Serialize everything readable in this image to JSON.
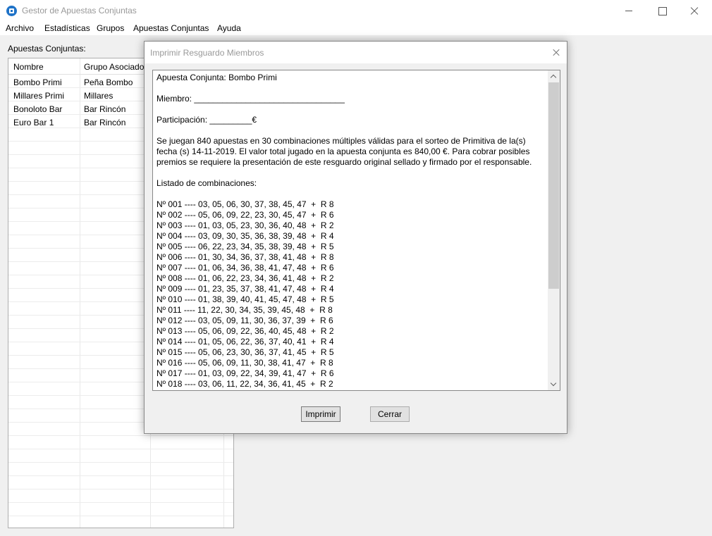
{
  "window": {
    "title": "Gestor de Apuestas Conjuntas"
  },
  "menu": [
    "Archivo",
    "Estadísticas",
    "Grupos",
    "Apuestas Conjuntas",
    "Ayuda"
  ],
  "sidebar": {
    "label": "Apuestas Conjuntas:",
    "columns": [
      "Nombre",
      "Grupo Asociado"
    ],
    "rows": [
      [
        "Bombo Primi",
        "Peña Bombo"
      ],
      [
        "Millares Primi",
        "Millares"
      ],
      [
        "Bonoloto Bar",
        "Bar Rincón"
      ],
      [
        "Euro Bar 1",
        "Bar Rincón"
      ]
    ]
  },
  "dialog": {
    "title": "Imprimir Resguardo Miembros",
    "header_line": "Apuesta Conjunta: Bombo Primi",
    "member_line": "Miembro: ________________________________",
    "participation_line": "Participación: _________€",
    "paragraph": "Se juegan 840 apuestas en 30 combinaciones múltiples válidas para el sorteo de Primitiva de la(s) fecha (s) 14-11-2019. El valor total jugado en la apuesta conjunta es 840,00 €. Para cobrar posibles premios se requiere la presentación de este resguardo original sellado y firmado por el responsable.",
    "list_title": "Listado de combinaciones:",
    "combinations": [
      "Nº 001 ---- 03, 05, 06, 30, 37, 38, 45, 47  +  R 8",
      "Nº 002 ---- 05, 06, 09, 22, 23, 30, 45, 47  +  R 6",
      "Nº 003 ---- 01, 03, 05, 23, 30, 36, 40, 48  +  R 2",
      "Nº 004 ---- 03, 09, 30, 35, 36, 38, 39, 48  +  R 4",
      "Nº 005 ---- 06, 22, 23, 34, 35, 38, 39, 48  +  R 5",
      "Nº 006 ---- 01, 30, 34, 36, 37, 38, 41, 48  +  R 8",
      "Nº 007 ---- 01, 06, 34, 36, 38, 41, 47, 48  +  R 6",
      "Nº 008 ---- 01, 06, 22, 23, 34, 36, 41, 48  +  R 2",
      "Nº 009 ---- 01, 23, 35, 37, 38, 41, 47, 48  +  R 4",
      "Nº 010 ---- 01, 38, 39, 40, 41, 45, 47, 48  +  R 5",
      "Nº 011 ---- 11, 22, 30, 34, 35, 39, 45, 48  +  R 8",
      "Nº 012 ---- 03, 05, 09, 11, 30, 36, 37, 39  +  R 6",
      "Nº 013 ---- 05, 06, 09, 22, 36, 40, 45, 48  +  R 2",
      "Nº 014 ---- 01, 05, 06, 22, 36, 37, 40, 41  +  R 4",
      "Nº 015 ---- 05, 06, 23, 30, 36, 37, 41, 45  +  R 5",
      "Nº 016 ---- 05, 06, 09, 11, 30, 38, 41, 47  +  R 8",
      "Nº 017 ---- 01, 03, 09, 22, 34, 39, 41, 47  +  R 6",
      "Nº 018 ---- 03, 06, 11, 22, 34, 36, 41, 45  +  R 2"
    ],
    "buttons": {
      "print": "Imprimir",
      "close": "Cerrar"
    }
  }
}
